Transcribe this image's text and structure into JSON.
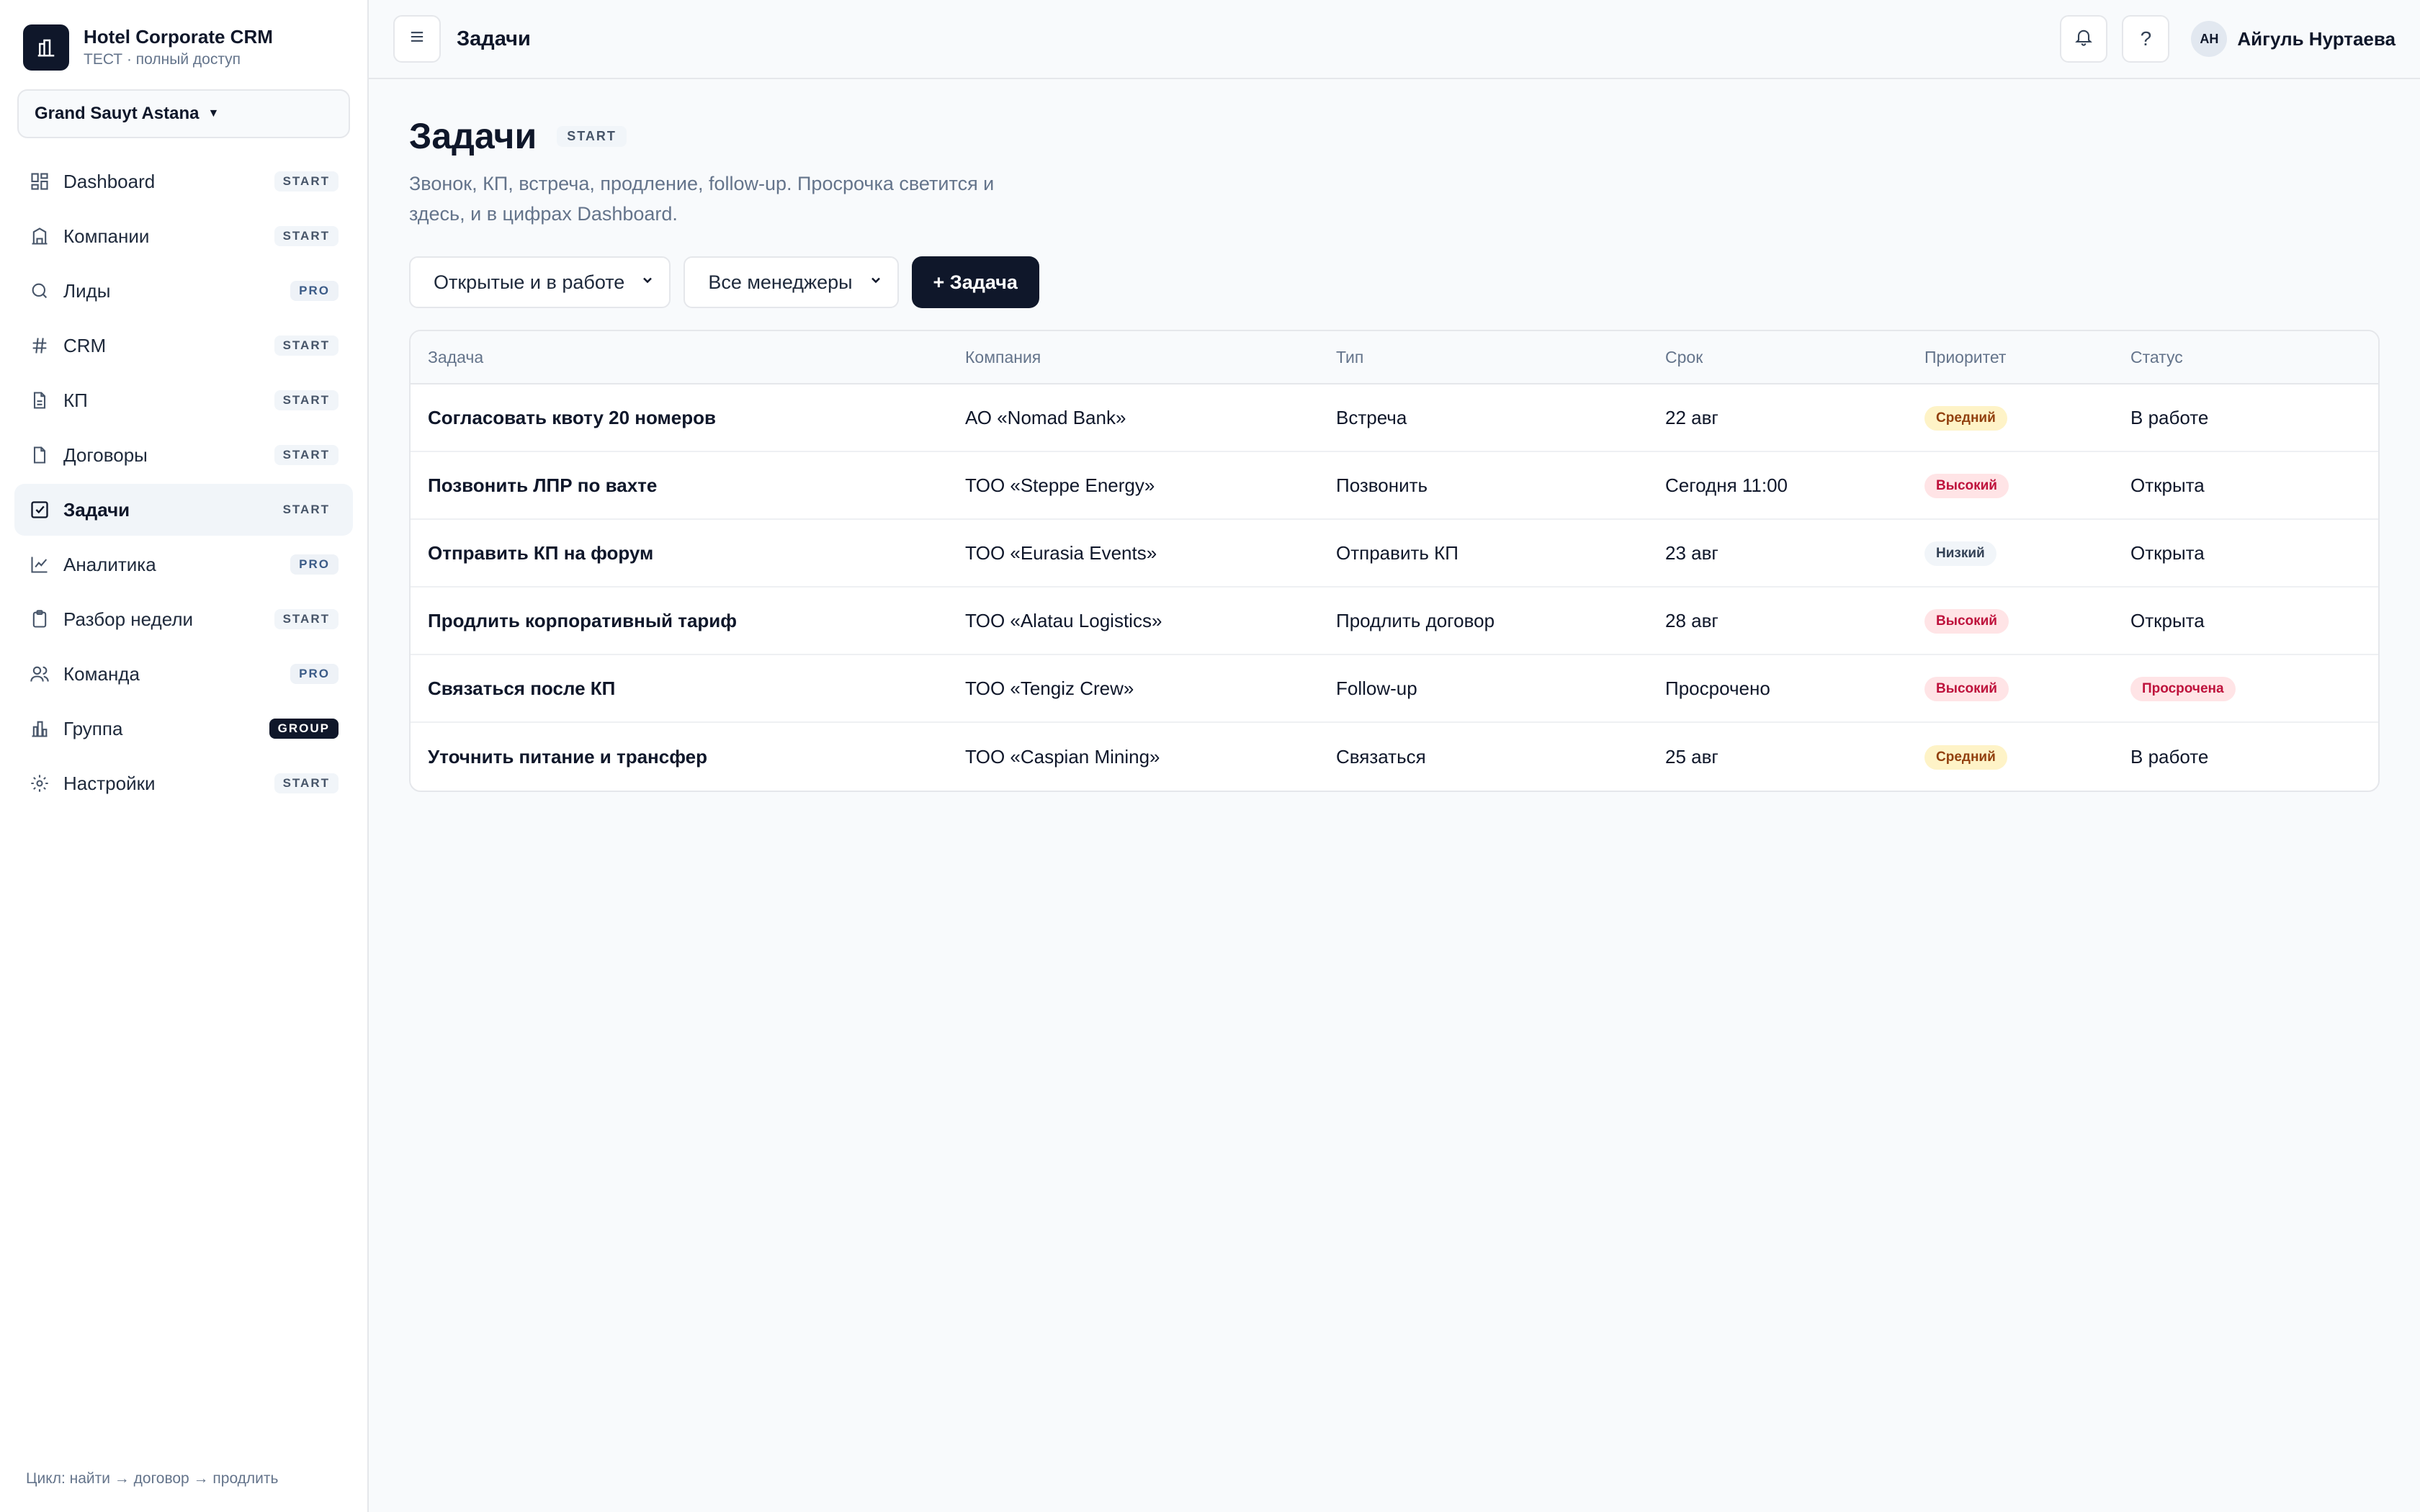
{
  "brand": {
    "title": "Hotel Corporate CRM",
    "subtitle": "ТЕСТ · полный доступ"
  },
  "hotel_selector": {
    "value": "Grand Sauyt Astana"
  },
  "sidebar": {
    "items": [
      {
        "label": "Dashboard",
        "badge": "START",
        "icon": "dashboard-icon"
      },
      {
        "label": "Компании",
        "badge": "START",
        "icon": "building-icon"
      },
      {
        "label": "Лиды",
        "badge": "PRO",
        "icon": "search-icon"
      },
      {
        "label": "CRM",
        "badge": "START",
        "icon": "hash-icon"
      },
      {
        "label": "КП",
        "badge": "START",
        "icon": "document-icon"
      },
      {
        "label": "Договоры",
        "badge": "START",
        "icon": "file-icon"
      },
      {
        "label": "Задачи",
        "badge": "START",
        "icon": "checkbox-icon",
        "active": true
      },
      {
        "label": "Аналитика",
        "badge": "PRO",
        "icon": "chart-line-icon"
      },
      {
        "label": "Разбор недели",
        "badge": "START",
        "icon": "clipboard-icon"
      },
      {
        "label": "Команда",
        "badge": "PRO",
        "icon": "users-icon"
      },
      {
        "label": "Группа",
        "badge": "GROUP",
        "icon": "bar-chart-icon"
      },
      {
        "label": "Настройки",
        "badge": "START",
        "icon": "settings-icon"
      }
    ],
    "footer": "Цикл: найти → договор → продлить"
  },
  "topbar": {
    "title": "Задачи",
    "help_label": "?",
    "user": {
      "initials": "АН",
      "name": "Айгуль Нуртаева"
    }
  },
  "page": {
    "title": "Задачи",
    "badge": "START",
    "description": "Звонок, КП, встреча, продление, follow-up. Просрочка светится и здесь, и в цифрах Dashboard."
  },
  "filters": {
    "status": "Открытые и в работе",
    "manager": "Все менеджеры",
    "add_button": "+ Задача"
  },
  "table": {
    "headers": [
      "Задача",
      "Компания",
      "Тип",
      "Срок",
      "Приоритет",
      "Статус"
    ],
    "rows": [
      {
        "task": "Согласовать квоту 20 номеров",
        "company": "АО «Nomad Bank»",
        "type": "Встреча",
        "due": "22 авг",
        "priority": "Средний",
        "priority_level": "medium",
        "status": "В работе",
        "status_overdue": false
      },
      {
        "task": "Позвонить ЛПР по вахте",
        "company": "ТОО «Steppe Energy»",
        "type": "Позвонить",
        "due": "Сегодня 11:00",
        "priority": "Высокий",
        "priority_level": "high",
        "status": "Открыта",
        "status_overdue": false
      },
      {
        "task": "Отправить КП на форум",
        "company": "ТОО «Eurasia Events»",
        "type": "Отправить КП",
        "due": "23 авг",
        "priority": "Низкий",
        "priority_level": "low",
        "status": "Открыта",
        "status_overdue": false
      },
      {
        "task": "Продлить корпоративный тариф",
        "company": "ТОО «Alatau Logistics»",
        "type": "Продлить договор",
        "due": "28 авг",
        "priority": "Высокий",
        "priority_level": "high",
        "status": "Открыта",
        "status_overdue": false
      },
      {
        "task": "Связаться после КП",
        "company": "ТОО «Tengiz Crew»",
        "type": "Follow-up",
        "due": "Просрочено",
        "priority": "Высокий",
        "priority_level": "high",
        "status": "Просрочена",
        "status_overdue": true
      },
      {
        "task": "Уточнить питание и трансфер",
        "company": "ТОО «Caspian Mining»",
        "type": "Связаться",
        "due": "25 авг",
        "priority": "Средний",
        "priority_level": "medium",
        "status": "В работе",
        "status_overdue": false
      }
    ]
  }
}
